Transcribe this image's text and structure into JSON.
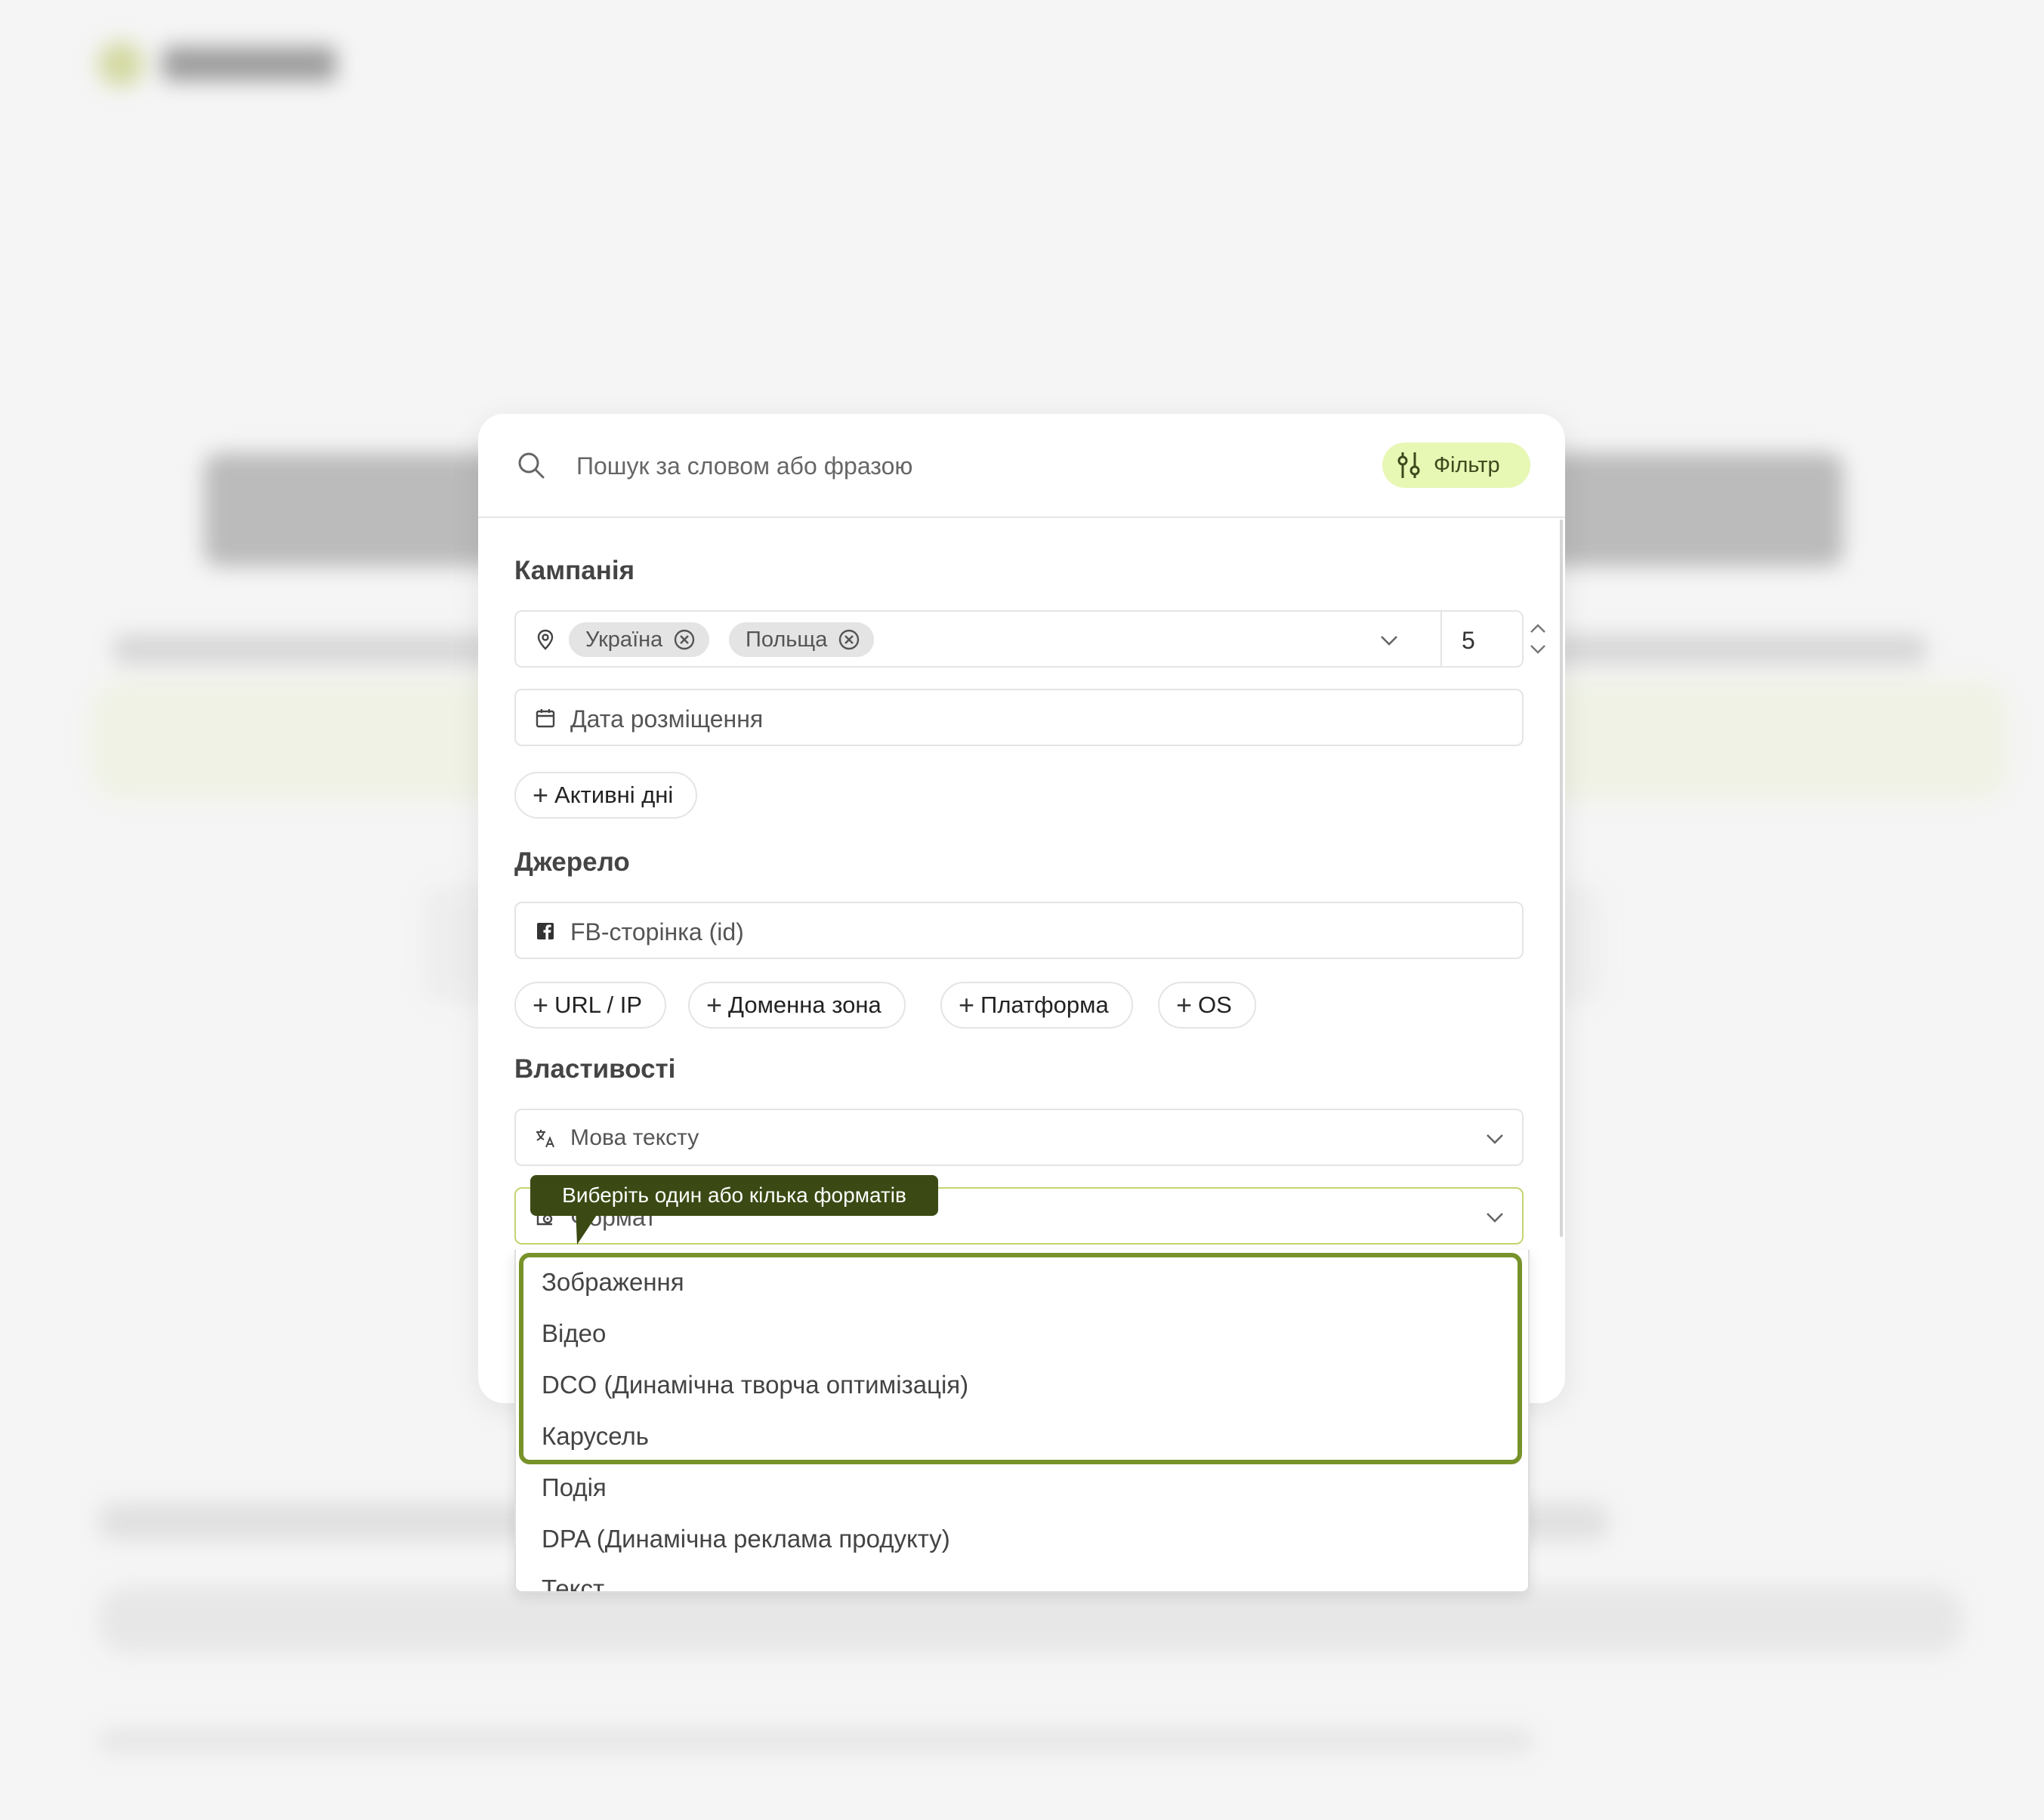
{
  "search": {
    "placeholder": "Пошук за словом або фразою"
  },
  "filter_button": {
    "label": "Фільтр"
  },
  "campaign": {
    "title": "Кампанія",
    "countries": [
      "Україна",
      "Польща"
    ],
    "count": "5",
    "date_placeholder": "Дата розміщення",
    "active_days_label": "Активні дні"
  },
  "source": {
    "title": "Джерело",
    "fb_placeholder": "FB-сторінка (id)",
    "pills": [
      "URL / IP",
      "Доменна зона",
      "Платформа",
      "OS"
    ]
  },
  "properties": {
    "title": "Властивості",
    "language_placeholder": "Мова тексту",
    "format_placeholder": "Формат"
  },
  "tooltip": {
    "text": "Виберіть один або кілька форматів"
  },
  "format_options": [
    "Зображення",
    "Відео",
    "DCO (Динамічна творча оптимізація)",
    "Карусель",
    "Подія",
    "DPA (Динамічна реклама продукту)",
    "Текст"
  ],
  "colors": {
    "accent": "#78922a",
    "filter_bg": "#e7f7b4",
    "tooltip_bg": "#3b4a14"
  }
}
